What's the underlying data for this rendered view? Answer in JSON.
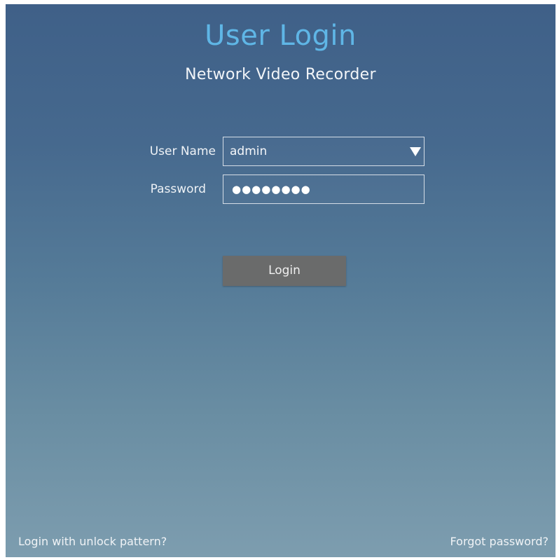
{
  "header": {
    "title": "User Login",
    "subtitle": "Network Video Recorder"
  },
  "form": {
    "username_label": "User Name",
    "username_value": "admin",
    "password_label": "Password",
    "password_value": "●●●●●●●●"
  },
  "actions": {
    "login_label": "Login",
    "unlock_pattern_label": "Login with unlock pattern?",
    "forgot_password_label": "Forgot password?"
  },
  "icons": {
    "dropdown": "chevron-down-icon"
  },
  "colors": {
    "title": "#5fb6e6",
    "button": "#6a6b6b"
  }
}
